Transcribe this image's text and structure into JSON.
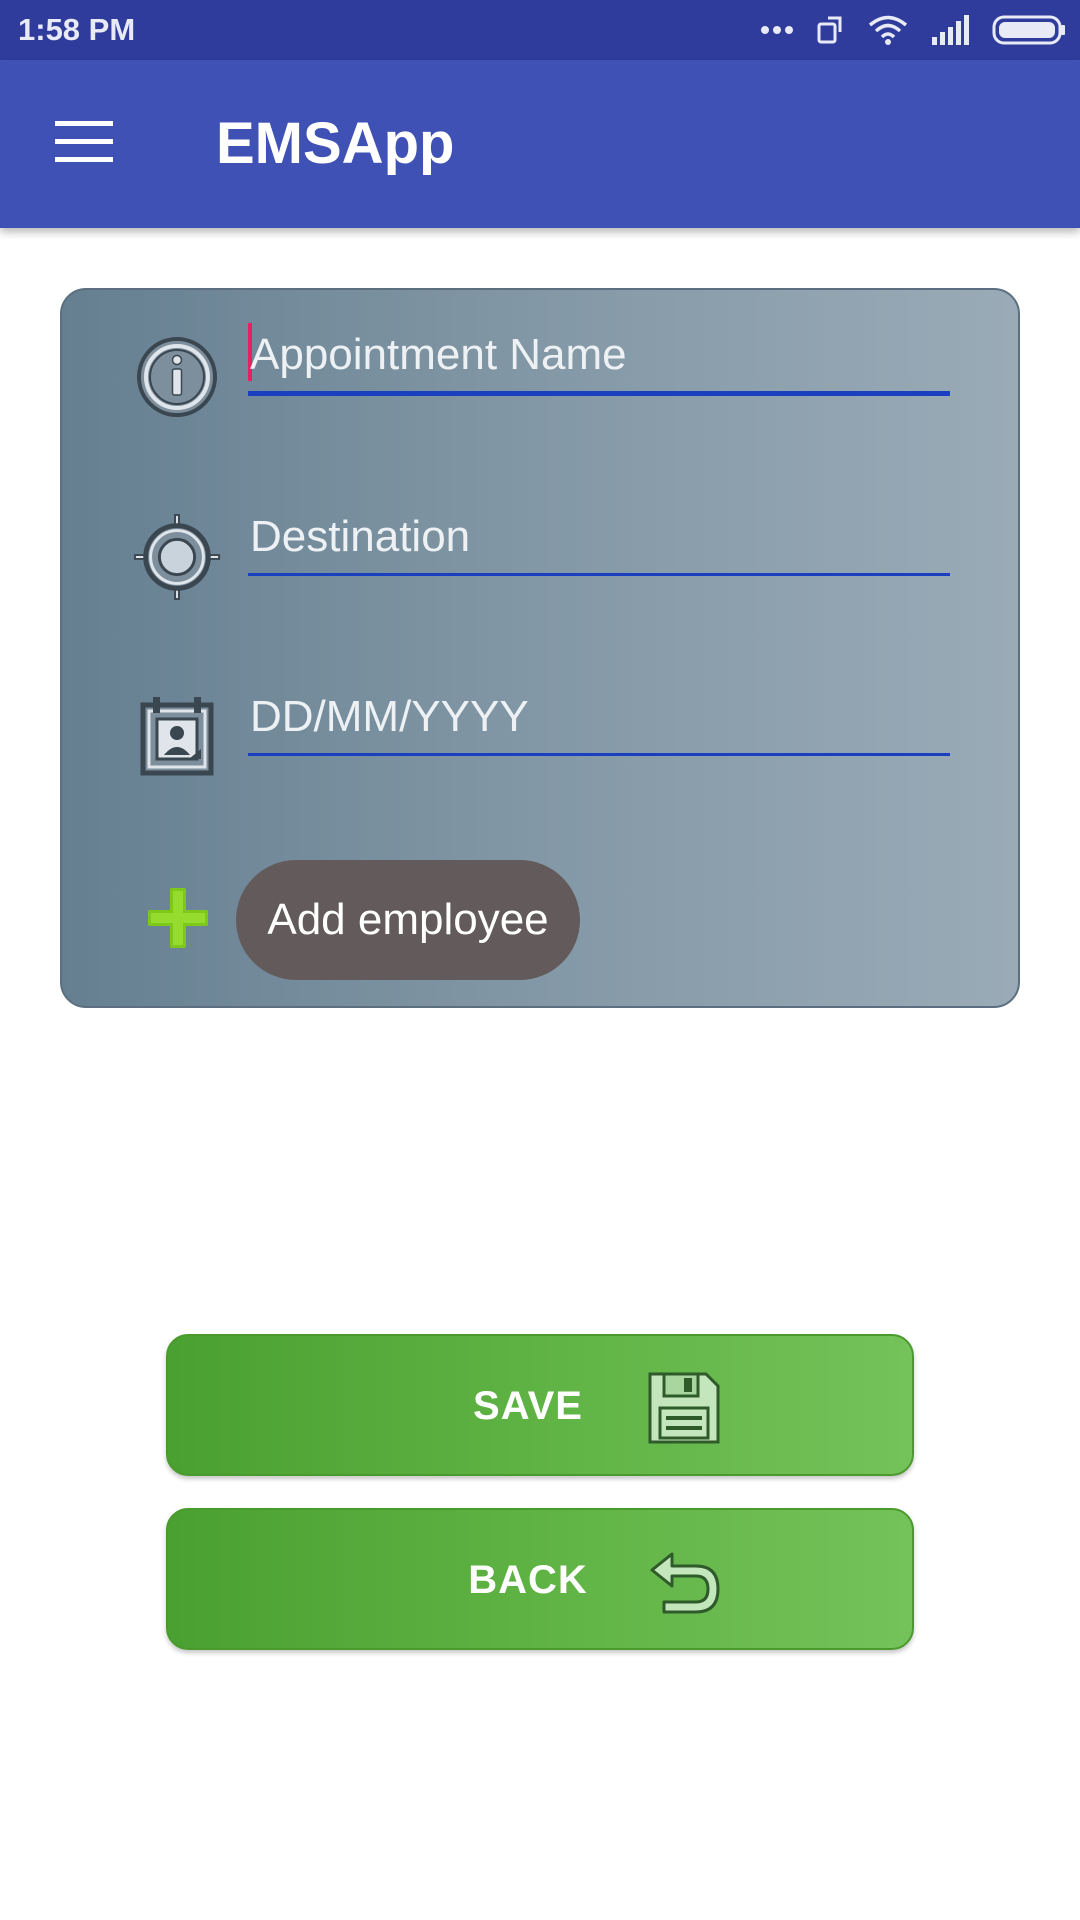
{
  "status_bar": {
    "time": "1:58 PM",
    "icons": [
      "more-dots-icon",
      "screen-rotate-icon",
      "wifi-icon",
      "signal-icon",
      "battery-icon"
    ]
  },
  "app_bar": {
    "title": "EMSApp",
    "menu_icon": "hamburger-menu-icon"
  },
  "form": {
    "appointment_name": {
      "placeholder": "Appointment Name",
      "value": "",
      "icon": "info-icon"
    },
    "destination": {
      "placeholder": "Destination",
      "value": "",
      "icon": "target-icon"
    },
    "date": {
      "placeholder": "DD/MM/YYYY",
      "value": "",
      "icon": "calendar-icon"
    },
    "add_employee": {
      "label": "Add employee",
      "icon": "plus-icon"
    }
  },
  "buttons": {
    "save": {
      "label": "SAVE",
      "icon": "floppy-disk-icon"
    },
    "back": {
      "label": "BACK",
      "icon": "undo-arrow-icon"
    }
  },
  "colors": {
    "status_bar": "#2f3c9c",
    "app_bar": "#3f51b5",
    "field_underline": "#1a3fbf",
    "caret": "#e91e63",
    "add_employee_bg": "#635b5b",
    "button_green": "#5fb344"
  }
}
